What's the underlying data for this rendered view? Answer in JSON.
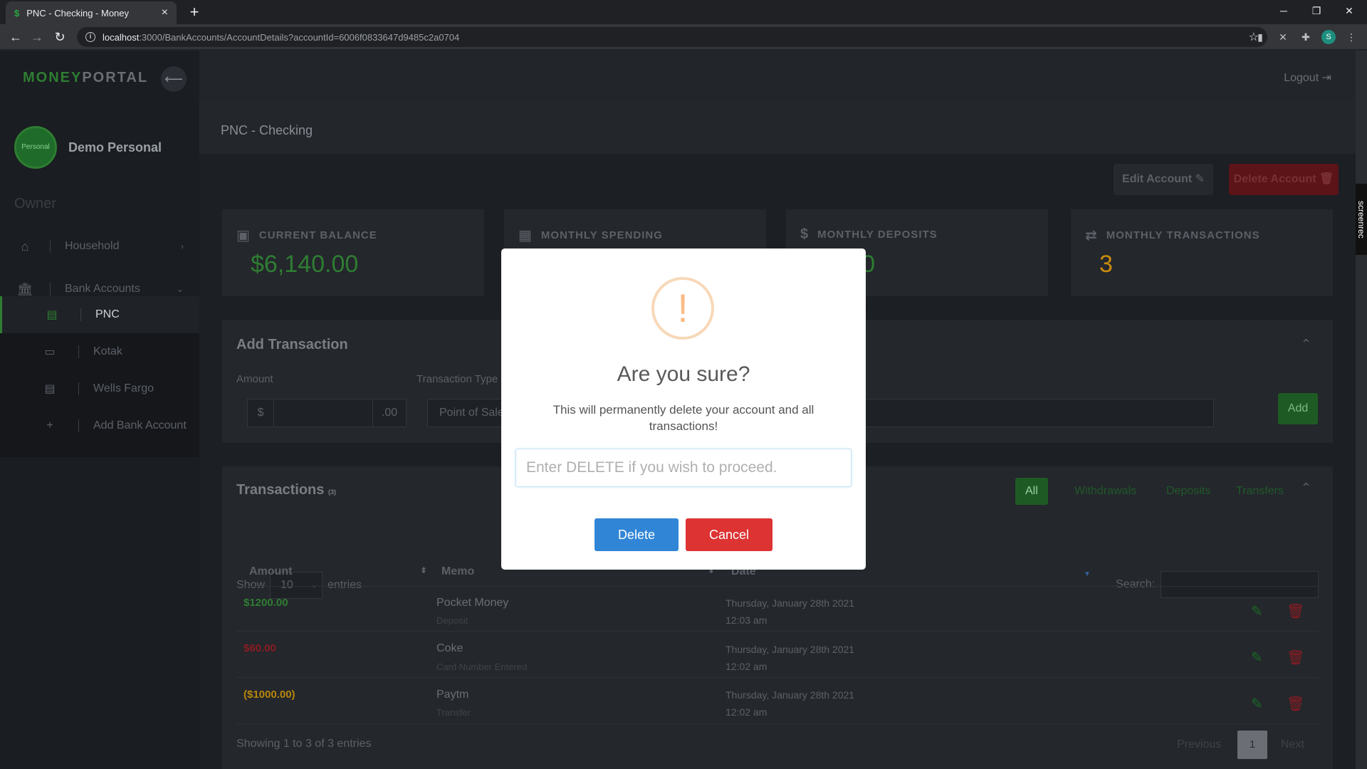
{
  "browser": {
    "tab_title": "PNC - Checking - Money",
    "url_host": "localhost",
    "url_rest": ":3000/BankAccounts/AccountDetails?accountId=6006f0833647d9485c2a0704",
    "profile_initial": "S"
  },
  "sidebar": {
    "brand_part1": "MONEY",
    "brand_part2": "PORTAL",
    "avatar_text": "Personal",
    "user_name": "Demo Personal",
    "role": "Owner",
    "items": [
      {
        "label": "Household"
      },
      {
        "label": "Bank Accounts"
      }
    ],
    "accounts": [
      {
        "label": "PNC"
      },
      {
        "label": "Kotak"
      },
      {
        "label": "Wells Fargo"
      },
      {
        "label": "Add Bank Account"
      }
    ]
  },
  "header": {
    "logout": "Logout",
    "page_title": "PNC - Checking",
    "edit_account": "Edit Account",
    "delete_account": "Delete Account"
  },
  "cards": [
    {
      "label": "CURRENT BALANCE",
      "value": "$6,140.00",
      "color": "#2e7d32"
    },
    {
      "label": "MONTHLY SPENDING",
      "value": "",
      "color": "#2e7d32"
    },
    {
      "label": "MONTHLY DEPOSITS",
      "value": "00.00",
      "color": "#2e7d32"
    },
    {
      "label": "MONTHLY TRANSACTIONS",
      "value": "3",
      "color": "#c98b0f"
    }
  ],
  "add_transaction": {
    "title": "Add Transaction",
    "amount_label": "Amount",
    "currency": "$",
    "cents": ".00",
    "type_label": "Transaction Type",
    "type_value": "Point of Sale",
    "add_button": "Add"
  },
  "transactions": {
    "title": "Transactions",
    "count": "(3)",
    "filters": [
      "All",
      "Withdrawals",
      "Deposits",
      "Transfers"
    ],
    "show_label": "Show",
    "show_value": "10",
    "entries_label": "entries",
    "search_label": "Search:",
    "columns": [
      "Amount",
      "Memo",
      "Date"
    ],
    "rows": [
      {
        "amount": "$1200.00",
        "amount_color": "#2e7d32",
        "memo": "Pocket Money",
        "sub": "Deposit",
        "date": "Thursday, January 28th 2021",
        "time": "12:03 am"
      },
      {
        "amount": "$60.00",
        "amount_color": "#8a1c22",
        "memo": "Coke",
        "sub": "Card Number Entered",
        "date": "Thursday, January 28th 2021",
        "time": "12:02 am"
      },
      {
        "amount": "($1000.00)",
        "amount_color": "#b8860b",
        "memo": "Paytm",
        "sub": "Transfer",
        "date": "Thursday, January 28th 2021",
        "time": "12:02 am"
      }
    ],
    "footer": "Showing 1 to 3 of 3 entries",
    "prev": "Previous",
    "page": "1",
    "next": "Next"
  },
  "modal": {
    "icon": "!",
    "title": "Are you sure?",
    "text": "This will permanently delete your account and all transactions!",
    "input_placeholder": "Enter DELETE if you wish to proceed.",
    "delete_button": "Delete",
    "cancel_button": "Cancel"
  },
  "screenrec_label": "screenrec"
}
